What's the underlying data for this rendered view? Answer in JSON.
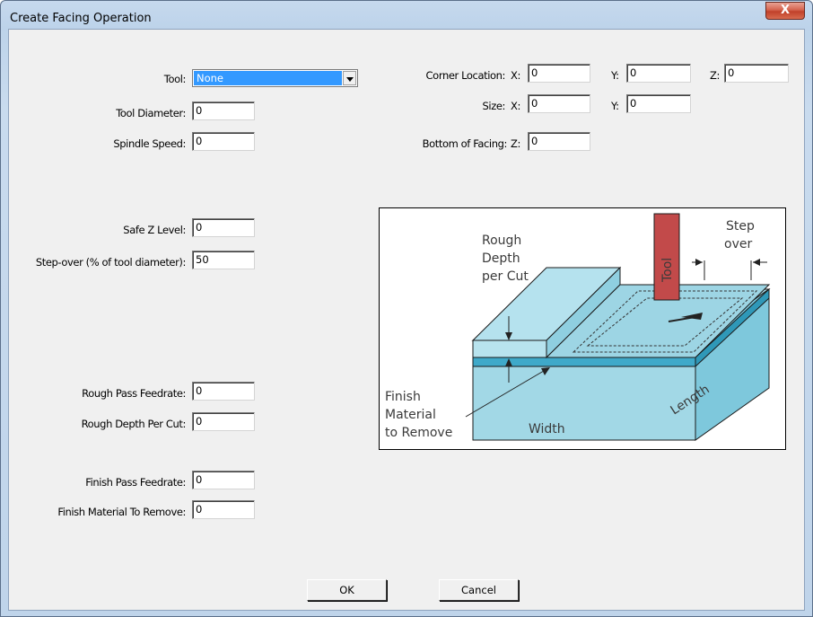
{
  "window": {
    "title": "Create Facing Operation",
    "close_label": "X"
  },
  "left": {
    "tool_label": "Tool:",
    "tool_value": "None",
    "tool_diameter_label": "Tool Diameter:",
    "tool_diameter_value": "0",
    "spindle_speed_label": "Spindle Speed:",
    "spindle_speed_value": "0",
    "safe_z_label": "Safe Z Level:",
    "safe_z_value": "0",
    "stepover_label": "Step-over (% of tool diameter):",
    "stepover_value": "50",
    "rough_feed_label": "Rough Pass Feedrate:",
    "rough_feed_value": "0",
    "rough_depth_label": "Rough Depth Per Cut:",
    "rough_depth_value": "0",
    "finish_feed_label": "Finish Pass Feedrate:",
    "finish_feed_value": "0",
    "finish_material_label": "Finish Material To Remove:",
    "finish_material_value": "0"
  },
  "right": {
    "corner_label": "Corner Location:",
    "corner_x_label": "X:",
    "corner_x_value": "0",
    "corner_y_label": "Y:",
    "corner_y_value": "0",
    "corner_z_label": "Z:",
    "corner_z_value": "0",
    "size_label": "Size:",
    "size_x_label": "X:",
    "size_x_value": "0",
    "size_y_label": "Y:",
    "size_y_value": "0",
    "bottom_label": "Bottom of Facing:",
    "bottom_z_label": "Z:",
    "bottom_z_value": "0"
  },
  "diagram": {
    "rough_line1": "Rough",
    "rough_line2": "Depth",
    "rough_line3": "per Cut",
    "tool": "Tool",
    "step_line1": "Step",
    "step_line2": "over",
    "finish_line1": "Finish",
    "finish_line2": "Material",
    "finish_line3": "to Remove",
    "width": "Width",
    "length": "Length"
  },
  "buttons": {
    "ok": "OK",
    "cancel": "Cancel"
  }
}
